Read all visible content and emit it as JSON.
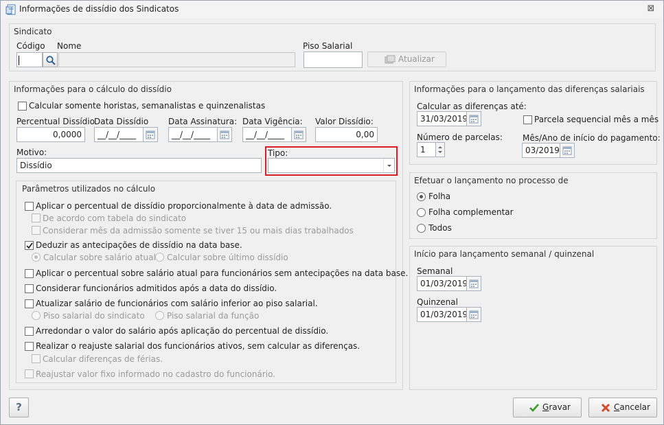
{
  "window": {
    "title": "Informações de dissídio dos Sindicatos",
    "close": "⊠"
  },
  "sindicato": {
    "title": "Sindicato",
    "codigo_label": "Código",
    "nome_label": "Nome",
    "piso_label": "Piso Salarial",
    "codigo_value": "",
    "nome_value": "",
    "piso_value": "",
    "atualizar": "Atualizar"
  },
  "calculo": {
    "title": "Informações para o cálculo do dissídio",
    "only_hourly": "Calcular somente horistas, semanalistas e quinzenalistas",
    "percentual_label": "Percentual Dissídio",
    "percentual_value": "0,0000",
    "data_dissidio_label": "Data Dissídio",
    "data_dissidio_value": "__/__/____",
    "data_assinatura_label": "Data Assinatura:",
    "data_assinatura_value": "__/__/____",
    "data_vigencia_label": "Data Vigência:",
    "data_vigencia_value": "__/__/____",
    "valor_label": "Valor Dissídio:",
    "valor_value": "0,00",
    "motivo_label": "Motivo:",
    "motivo_value": "Dissídio",
    "tipo_label": "Tipo:",
    "tipo_value": ""
  },
  "parametros": {
    "title": "Parâmetros utilizados no cálculo",
    "items": [
      "Aplicar o percentual de dissídio proporcionalmente à data de admissão.",
      "De acordo com tabela do sindicato",
      "Considerar mês da admissão somente se tiver 15 ou mais dias trabalhados",
      "Deduzir as antecipações de dissídio na data base.",
      "Calcular sobre salário atual",
      "Calcular sobre último dissídio",
      "Aplicar o percentual sobre salário atual para funcionários sem antecipações na data base.",
      "Considerar funcionários admitidos após a data do dissídio.",
      "Atualizar salário de funcionários com salário inferior ao piso salarial.",
      "Piso salarial do sindicato",
      "Piso salarial da função",
      "Arredondar o valor do salário após aplicação do percentual de dissídio.",
      "Realizar o reajuste salarial dos funcionários ativos, sem calcular as diferenças.",
      "Calcular diferenças de férias.",
      "Reajustar valor fixo informado no cadastro do funcionário."
    ]
  },
  "lancamento": {
    "title": "Informações para o lançamento das diferenças salariais",
    "calcular_label": "Calcular as diferenças até:",
    "calcular_value": "31/03/2019",
    "parcela_seq": "Parcela sequencial mês a mês",
    "num_parcelas_label": "Número de parcelas:",
    "num_parcelas_value": "1",
    "mes_ano_label": "Mês/Ano de início do pagamento:",
    "mes_ano_value": "03/2019"
  },
  "processo": {
    "title": "Efetuar o lançamento no processo de",
    "options": [
      "Folha",
      "Folha complementar",
      "Todos"
    ]
  },
  "semanal": {
    "title": "Início para lançamento semanal / quinzenal",
    "semanal_label": "Semanal",
    "semanal_value": "01/03/2019",
    "quinzenal_label": "Quinzenal",
    "quinzenal_value": "01/03/2019"
  },
  "footer": {
    "help": "?",
    "gravar_first": "G",
    "gravar_rest": "ravar",
    "cancelar_first": "C",
    "cancelar_rest": "ancelar"
  },
  "colors": {
    "highlight": "#d92027",
    "check_green": "#3a9a2e",
    "cancel_red": "#d34a2a"
  }
}
